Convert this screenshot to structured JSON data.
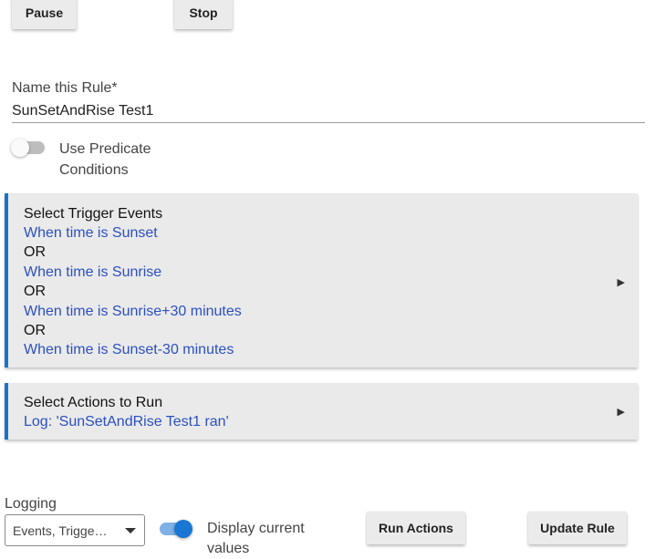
{
  "toolbar": {
    "pause_label": "Pause",
    "stop_label": "Stop"
  },
  "rule_name": {
    "label": "Name this Rule*",
    "value": "SunSetAndRise Test1"
  },
  "predicate": {
    "label": "Use Predicate Conditions",
    "enabled": false
  },
  "triggers": {
    "title": "Select Trigger Events",
    "items": [
      "When time is Sunset",
      "OR",
      "When time is Sunrise",
      "OR",
      "When time is Sunrise+30 minutes",
      "OR",
      "When time is Sunset-30 minutes"
    ],
    "expand_icon": "play-arrow-icon"
  },
  "actions": {
    "title": "Select Actions to Run",
    "items": [
      "Log: 'SunSetAndRise Test1 ran'"
    ],
    "expand_icon": "play-arrow-icon"
  },
  "logging": {
    "label": "Logging",
    "selected": "Events, Trigge…"
  },
  "display_current": {
    "label": "Display current values",
    "enabled": true
  },
  "footer": {
    "run_actions_label": "Run Actions",
    "update_rule_label": "Update Rule"
  },
  "colors": {
    "accent": "#1976d2",
    "panel_bg": "#eaeaea",
    "link_text": "#2b50c0"
  }
}
